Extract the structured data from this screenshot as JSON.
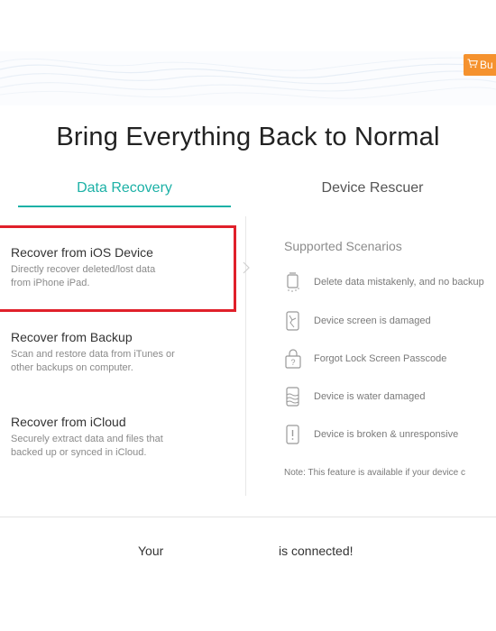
{
  "header": {
    "buy_label": "Bu",
    "title": "Bring Everything Back to Normal"
  },
  "tabs": [
    {
      "label": "Data Recovery",
      "active": true
    },
    {
      "label": "Device Rescuer",
      "active": false
    }
  ],
  "options": [
    {
      "title": "Recover from iOS Device",
      "desc_line1": "Directly recover deleted/lost data",
      "desc_line2": "from iPhone iPad.",
      "selected": true
    },
    {
      "title": "Recover from Backup",
      "desc_line1": "Scan and restore data from iTunes or",
      "desc_line2": "other backups on computer."
    },
    {
      "title": "Recover from iCloud",
      "desc_line1": "Securely extract data and files that",
      "desc_line2": "backed up or synced in iCloud."
    }
  ],
  "scenarios": {
    "title": "Supported Scenarios",
    "items": [
      {
        "label": "Delete data mistakenly, and no backup",
        "icon": "trash-icon"
      },
      {
        "label": "Device screen is damaged",
        "icon": "broken-screen-icon"
      },
      {
        "label": "Forgot Lock Screen Passcode",
        "icon": "lock-question-icon"
      },
      {
        "label": "Device is water damaged",
        "icon": "water-damage-icon"
      },
      {
        "label": "Device is broken & unresponsive",
        "icon": "device-alert-icon"
      }
    ],
    "note": "Note: This feature is available if your device c"
  },
  "status": {
    "prefix": "Your",
    "suffix": "is connected!"
  },
  "colors": {
    "accent": "#1cb1a6",
    "buy": "#f5922e",
    "highlight": "#e0202a"
  }
}
